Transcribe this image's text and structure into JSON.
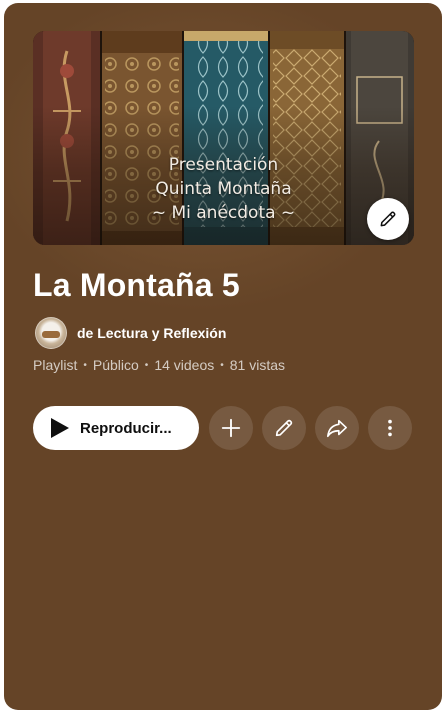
{
  "playlist": {
    "thumbnail": {
      "lines": [
        "Presentación",
        "Quinta Montaña",
        "~ Mi anécdota ~"
      ],
      "edit_icon": "pencil-icon"
    },
    "title": "La Montaña 5",
    "owner": {
      "name": "de Lectura y Reflexión"
    },
    "meta": {
      "type": "Playlist",
      "visibility": "Público",
      "videos": "14 videos",
      "views": "81 vistas"
    },
    "actions": {
      "play_label": "Reproducir...",
      "icons": [
        "play-icon",
        "plus-icon",
        "pencil-icon",
        "share-icon",
        "more-vert-icon"
      ]
    }
  },
  "colors": {
    "card_background": "#654427",
    "button_background": "#ffffff",
    "text_primary": "#ffffff"
  }
}
